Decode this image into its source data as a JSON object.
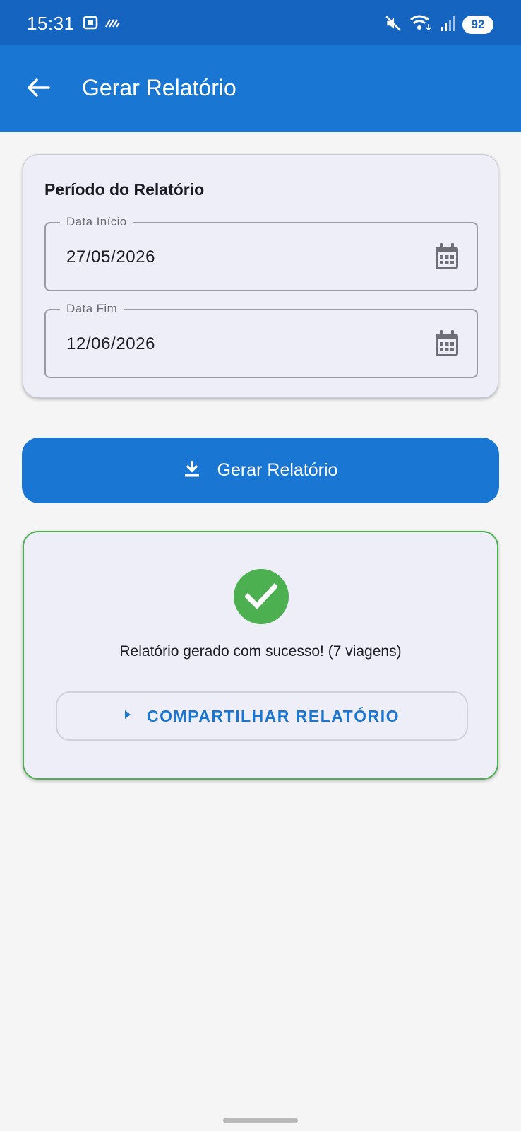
{
  "status_bar": {
    "time": "15:31",
    "battery": "92",
    "icons": [
      "screenshot-icon",
      "data-saver-icon",
      "mute-icon",
      "wifi-icon",
      "signal-icon"
    ]
  },
  "app_bar": {
    "title": "Gerar Relatório",
    "back_icon": "arrow-back-icon"
  },
  "period_card": {
    "title": "Período do Relatório",
    "start_field": {
      "label": "Data Início",
      "value": "27/05/2026",
      "icon": "calendar-icon"
    },
    "end_field": {
      "label": "Data Fim",
      "value": "12/06/2026",
      "icon": "calendar-icon"
    }
  },
  "generate_button": {
    "label": "Gerar Relatório",
    "icon": "download-icon"
  },
  "result_card": {
    "icon": "check-circle-icon",
    "message": "Relatório gerado com sucesso! (7 viagens)",
    "share_button": {
      "label": "COMPARTILHAR RELATÓRIO",
      "icon": "play-arrow-icon"
    }
  },
  "colors": {
    "status_bar": "#1565c0",
    "app_bar": "#1976d2",
    "primary": "#1976d2",
    "success": "#4caf50",
    "card_bg": "#eeeef8",
    "page_bg": "#f5f5f5"
  }
}
